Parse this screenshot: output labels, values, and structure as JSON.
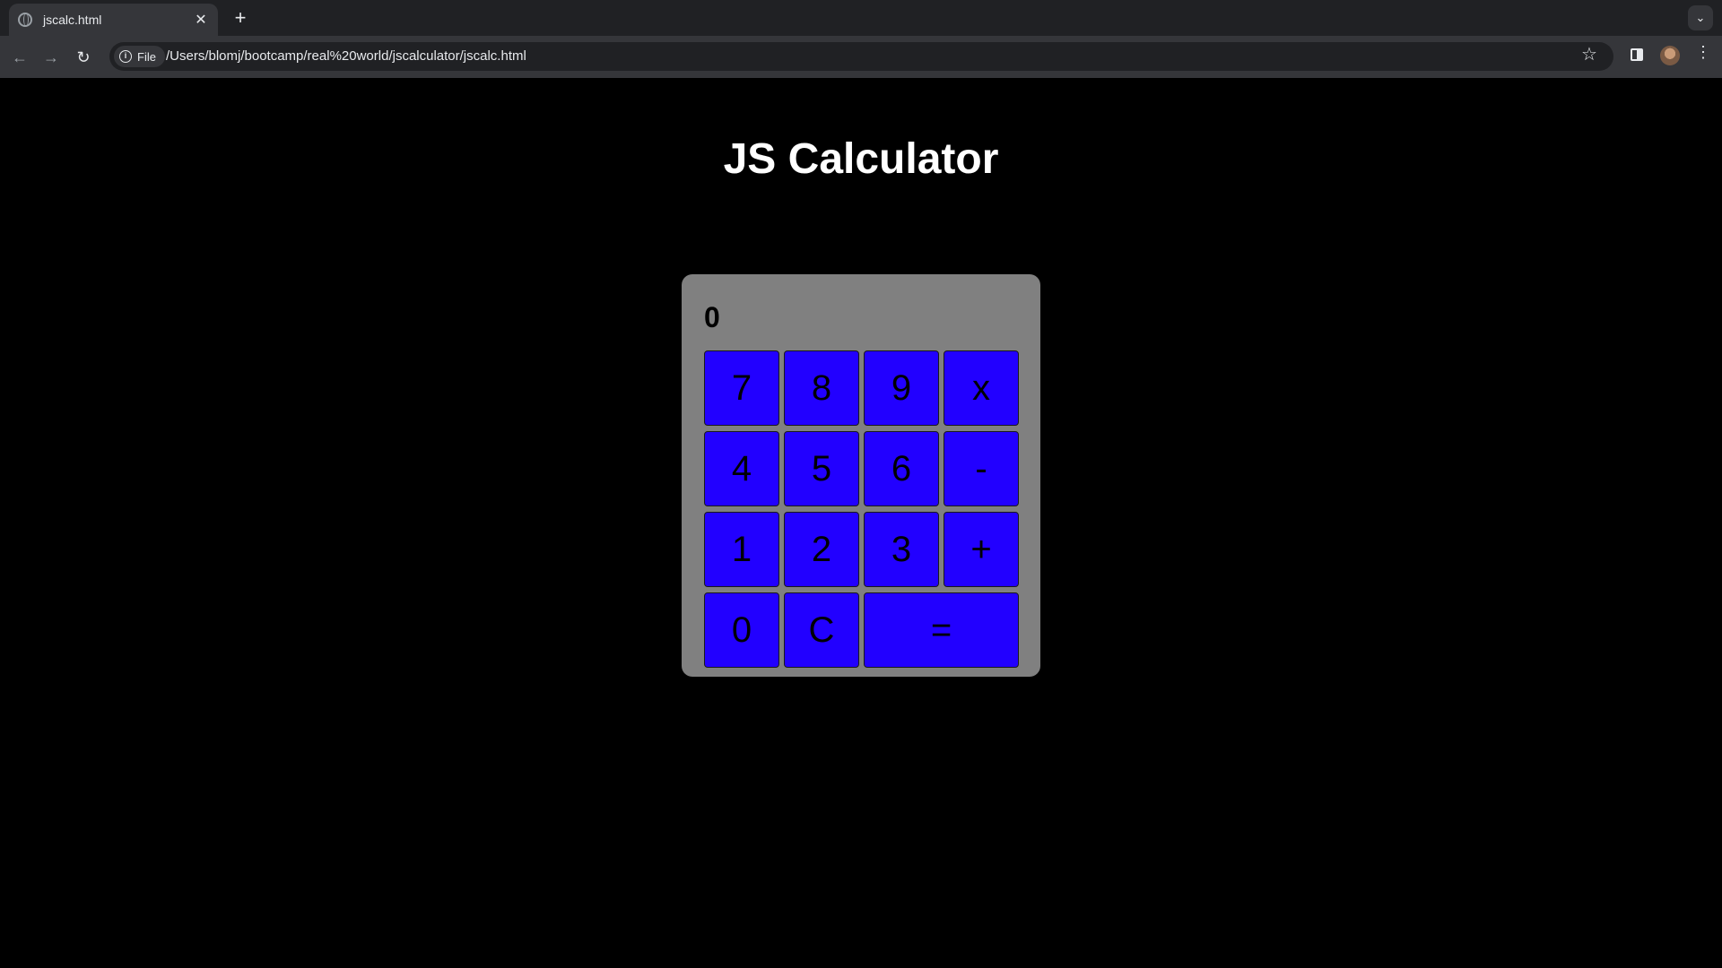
{
  "browser": {
    "tab_title": "jscalc.html",
    "chip_label": "File",
    "url": "/Users/blomj/bootcamp/real%20world/jscalculator/jscalc.html"
  },
  "page": {
    "heading": "JS Calculator"
  },
  "calculator": {
    "display_value": "0",
    "button_color": "#2200ff",
    "panel_color": "#808080",
    "keys": [
      "7",
      "8",
      "9",
      "x",
      "4",
      "5",
      "6",
      "-",
      "1",
      "2",
      "3",
      "+",
      "0",
      "C",
      "="
    ]
  }
}
